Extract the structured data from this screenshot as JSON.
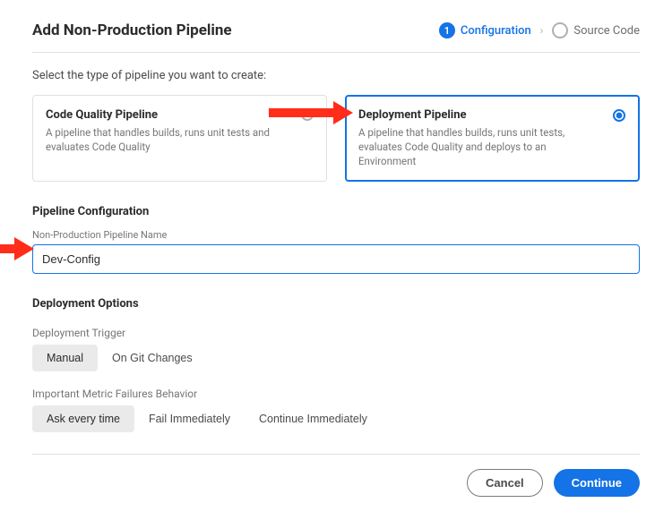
{
  "title": "Add Non-Production Pipeline",
  "stepper": {
    "step1_num": "1",
    "step1_label": "Configuration",
    "step2_label": "Source Code"
  },
  "prompt": "Select the type of pipeline you want to create:",
  "cards": {
    "quality": {
      "title": "Code Quality Pipeline",
      "desc": "A pipeline that handles builds, runs unit tests and evaluates Code Quality"
    },
    "deployment": {
      "title": "Deployment Pipeline",
      "desc": "A pipeline that handles builds, runs unit tests, evaluates Code Quality and deploys to an Environment"
    }
  },
  "config": {
    "heading": "Pipeline Configuration",
    "name_label": "Non-Production Pipeline Name",
    "name_value": "Dev-Config"
  },
  "deployment_options": {
    "heading": "Deployment Options",
    "trigger_label": "Deployment Trigger",
    "trigger_options": [
      "Manual",
      "On Git Changes"
    ],
    "behavior_label": "Important Metric Failures Behavior",
    "behavior_options": [
      "Ask every time",
      "Fail Immediately",
      "Continue Immediately"
    ]
  },
  "footer": {
    "cancel": "Cancel",
    "continue": "Continue"
  }
}
